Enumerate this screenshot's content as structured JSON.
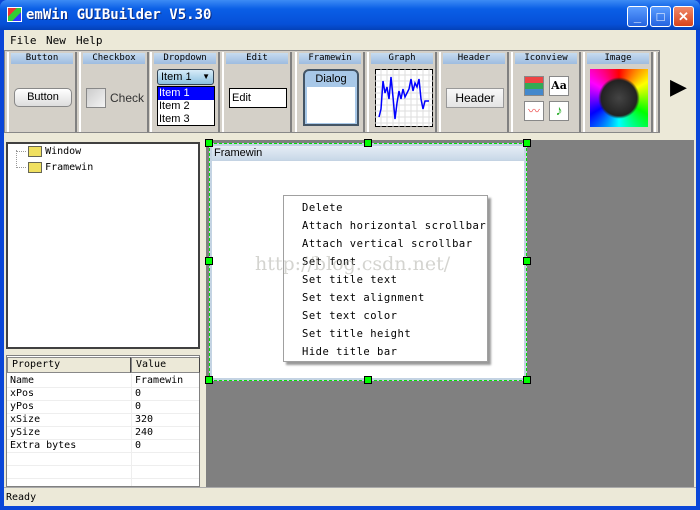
{
  "window": {
    "title": "emWin GUIBuilder V5.30",
    "minimize": "_",
    "maximize": "□",
    "close": "✕"
  },
  "menu": [
    {
      "label": "File"
    },
    {
      "label": "New"
    },
    {
      "label": "Help"
    }
  ],
  "toolbar": {
    "tiles": [
      "Button",
      "Checkbox",
      "Dropdown",
      "Edit",
      "Framewin",
      "Graph",
      "Header",
      "Iconview",
      "Image"
    ],
    "button_label": "Button",
    "checkbox_label": "Check",
    "dropdown_value": "Item 1",
    "dropdown_items": [
      "Item 1",
      "Item 2",
      "Item 3"
    ],
    "edit_value": "Edit",
    "framewin_label": "Dialog",
    "header_label": "Header",
    "scroll_right": "▶"
  },
  "tree": {
    "items": [
      "Window",
      "Framewin"
    ]
  },
  "properties": {
    "headers": [
      "Property",
      "Value"
    ],
    "rows": [
      [
        "Name",
        "Framewin"
      ],
      [
        "xPos",
        "0"
      ],
      [
        "yPos",
        "0"
      ],
      [
        "xSize",
        "320"
      ],
      [
        "ySize",
        "240"
      ],
      [
        "Extra bytes",
        "0"
      ]
    ]
  },
  "framewin": {
    "title": "Framewin"
  },
  "context_menu": {
    "items": [
      "Delete",
      "Attach horizontal scrollbar",
      "Attach vertical scrollbar",
      "Set font",
      "Set title text",
      "Set text alignment",
      "Set text color",
      "Set title height",
      "Hide title bar"
    ]
  },
  "watermark": "http://blog.csdn.net/",
  "status": "Ready",
  "colors": {
    "titlebar": "#0a5fe6",
    "workspace": "#808080",
    "selection": "#0000ff",
    "handle": "#00ff00"
  }
}
